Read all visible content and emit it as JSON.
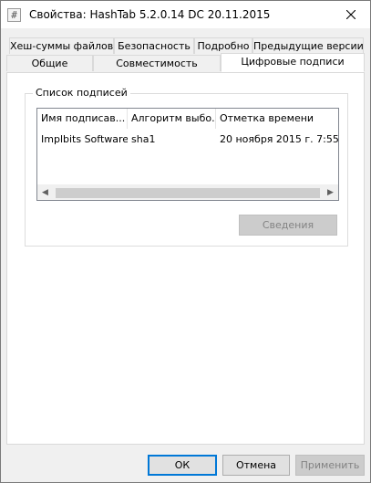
{
  "window": {
    "title": "Свойства: HashTab 5.2.0.14 DC 20.11.2015",
    "icon": "#",
    "close_icon": "close-icon"
  },
  "tabs": {
    "row_top": [
      "Хеш-суммы файлов",
      "Безопасность",
      "Подробно",
      "Предыдущие версии"
    ],
    "row_bottom": [
      "Общие",
      "Совместимость",
      "Цифровые подписи"
    ],
    "active": "Цифровые подписи"
  },
  "signatures": {
    "group_label": "Список подписей",
    "columns": [
      "Имя подписав...",
      "Алгоритм выбо...",
      "Отметка времени"
    ],
    "rows": [
      [
        "Implbits Software,...",
        "sha1",
        "20 ноября 2015 г. 7:55:..."
      ]
    ],
    "details_button": "Сведения"
  },
  "footer": {
    "ok": "ОК",
    "cancel": "Отмена",
    "apply": "Применить"
  }
}
